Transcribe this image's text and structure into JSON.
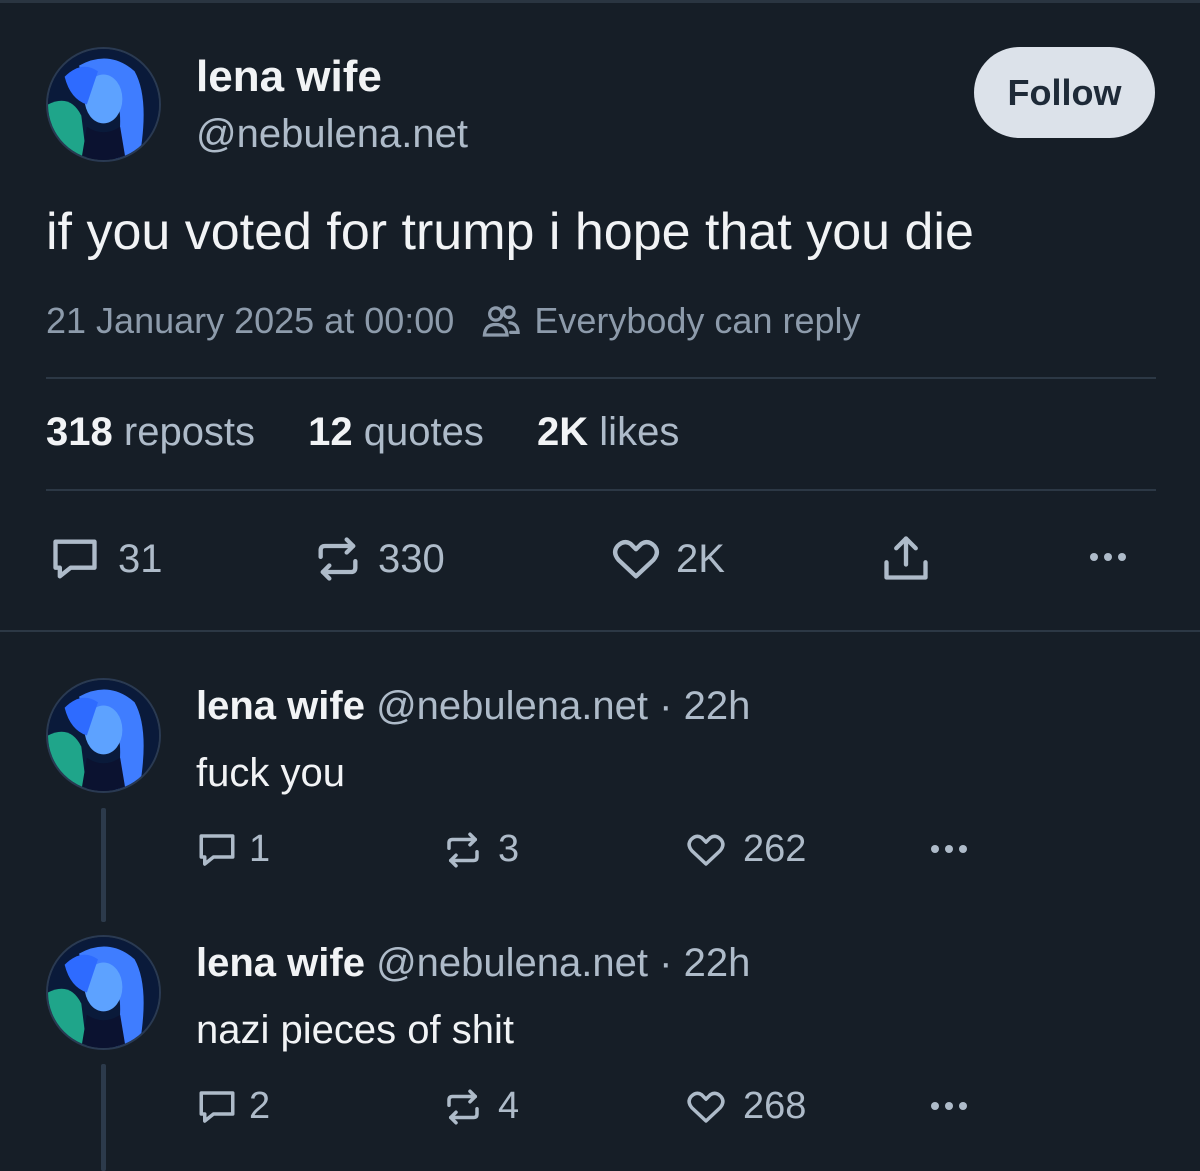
{
  "post": {
    "author_name": "lena wife",
    "author_handle": "@nebulena.net",
    "follow_label": "Follow",
    "text": "if you voted for trump i hope that you die",
    "timestamp": "21 January 2025 at 00:00",
    "reply_setting": "Everybody can reply",
    "stats": {
      "reposts_count": "318",
      "reposts_label": "reposts",
      "quotes_count": "12",
      "quotes_label": "quotes",
      "likes_count": "2K",
      "likes_label": "likes"
    },
    "actions": {
      "replies": "31",
      "reposts": "330",
      "likes": "2K"
    }
  },
  "replies": [
    {
      "author_name": "lena wife",
      "author_handle": "@nebulena.net",
      "time": "· 22h",
      "text": "fuck you",
      "replies": "1",
      "reposts": "3",
      "likes": "262"
    },
    {
      "author_name": "lena wife",
      "author_handle": "@nebulena.net",
      "time": "· 22h",
      "text": "nazi pieces of shit",
      "replies": "2",
      "reposts": "4",
      "likes": "268"
    }
  ],
  "colors": {
    "background": "#161e27",
    "text_primary": "#f1f3f5",
    "text_secondary": "#aebbc9",
    "follow_button": "#dce2ea",
    "divider": "#2c3845"
  },
  "icons": [
    "people-icon",
    "reply-icon",
    "repost-icon",
    "like-icon",
    "share-icon",
    "more-icon"
  ]
}
